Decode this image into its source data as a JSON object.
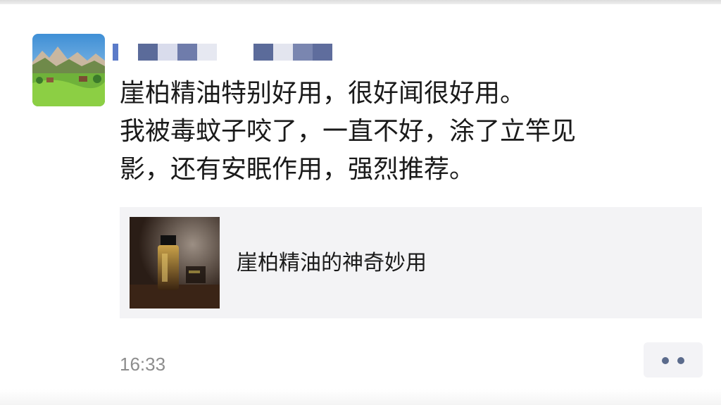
{
  "post": {
    "text": "崖柏精油特别好用，很好闻很好用。\n我被毒蚊子咬了，一直不好，涂了立竿见\n影，还有安眠作用，强烈推荐。",
    "timestamp": "16:33"
  },
  "link_card": {
    "title": "崖柏精油的神奇妙用"
  },
  "icons": {
    "avatar": "landscape-avatar",
    "username": "pixelated-username",
    "more": "more-dots-icon"
  },
  "colors": {
    "username_pixels": "#5b6b9a",
    "more_dots": "#5b6b8c",
    "card_background": "#f3f3f5",
    "timestamp": "#8d8d8d"
  }
}
